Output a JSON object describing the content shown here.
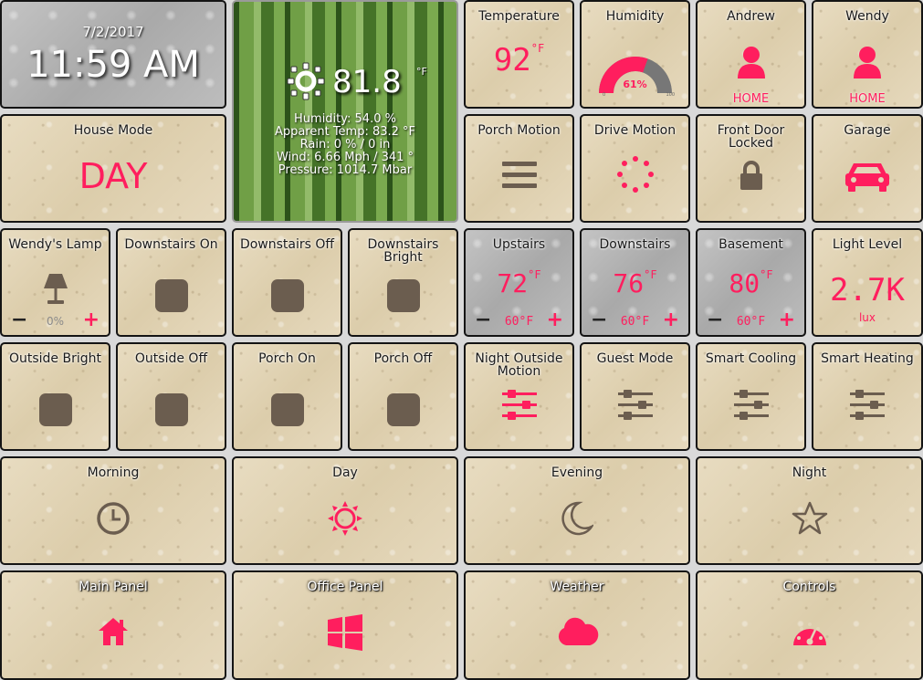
{
  "clock": {
    "date": "7/2/2017",
    "time": "11:59 AM"
  },
  "weather": {
    "temp": "81.8",
    "unit": "°F",
    "lines": [
      "Humidity: 54.0 %",
      "Apparent Temp: 83.2 °F",
      "Rain: 0 % / 0 in",
      "Wind: 6.66 Mph / 341 °",
      "Pressure: 1014.7 Mbar"
    ],
    "icon": "sun-icon"
  },
  "tiles": {
    "temperature": {
      "title": "Temperature",
      "value": "92",
      "unit": "°F"
    },
    "humidity": {
      "title": "Humidity",
      "value": "61%",
      "fraction": 0.61,
      "min": "0",
      "max": "100"
    },
    "andrew": {
      "title": "Andrew",
      "state": "HOME",
      "icon": "person-icon"
    },
    "wendy": {
      "title": "Wendy",
      "state": "HOME",
      "icon": "person-icon"
    },
    "house_mode": {
      "title": "House Mode",
      "value": "DAY"
    },
    "porch_motion": {
      "title": "Porch Motion",
      "icon": "menu-lines-icon"
    },
    "drive_motion": {
      "title": "Drive Motion",
      "icon": "spinner-icon"
    },
    "front_door": {
      "title": "Front Door Locked",
      "icon": "lock-icon"
    },
    "garage": {
      "title": "Garage",
      "icon": "car-icon"
    },
    "wendys_lamp": {
      "title": "Wendy's Lamp",
      "level": "0%",
      "minus": "−",
      "plus": "+"
    },
    "downstairs_on": {
      "title": "Downstairs On"
    },
    "downstairs_off": {
      "title": "Downstairs Off"
    },
    "downstairs_bright": {
      "title": "Downstairs Bright"
    },
    "upstairs": {
      "title": "Upstairs",
      "value": "72",
      "unit": "°F",
      "setpoint": "60°F",
      "minus": "−",
      "plus": "+"
    },
    "downstairs": {
      "title": "Downstairs",
      "value": "76",
      "unit": "°F",
      "setpoint": "60°F",
      "minus": "−",
      "plus": "+"
    },
    "basement": {
      "title": "Basement",
      "value": "80",
      "unit": "°F",
      "setpoint": "60°F",
      "minus": "−",
      "plus": "+"
    },
    "light_level": {
      "title": "Light Level",
      "value": "2.7K",
      "unit": "lux"
    },
    "outside_bright": {
      "title": "Outside Bright"
    },
    "outside_off": {
      "title": "Outside Off"
    },
    "porch_on": {
      "title": "Porch On"
    },
    "porch_off": {
      "title": "Porch Off"
    },
    "night_outside_motion": {
      "title": "Night Outside Motion",
      "icon": "sliders-icon"
    },
    "guest_mode": {
      "title": "Guest Mode",
      "icon": "sliders-icon"
    },
    "smart_cooling": {
      "title": "Smart Cooling",
      "icon": "sliders-icon"
    },
    "smart_heating": {
      "title": "Smart Heating",
      "icon": "sliders-icon"
    },
    "morning": {
      "title": "Morning",
      "icon": "clock-icon"
    },
    "day": {
      "title": "Day",
      "icon": "sun-icon"
    },
    "evening": {
      "title": "Evening",
      "icon": "moon-icon"
    },
    "night": {
      "title": "Night",
      "icon": "star-icon"
    },
    "main_panel": {
      "title": "Main Panel",
      "icon": "home-icon"
    },
    "office_panel": {
      "title": "Office Panel",
      "icon": "windows-icon"
    },
    "weather_panel": {
      "title": "Weather",
      "icon": "cloud-icon"
    },
    "controls": {
      "title": "Controls",
      "icon": "dashboard-icon"
    }
  },
  "colors": {
    "accent": "#ff1e5e",
    "icon_dark": "#6b5d4f",
    "tile_bg": "#e3d6b8",
    "tile_gray": "#b8b8b8"
  }
}
